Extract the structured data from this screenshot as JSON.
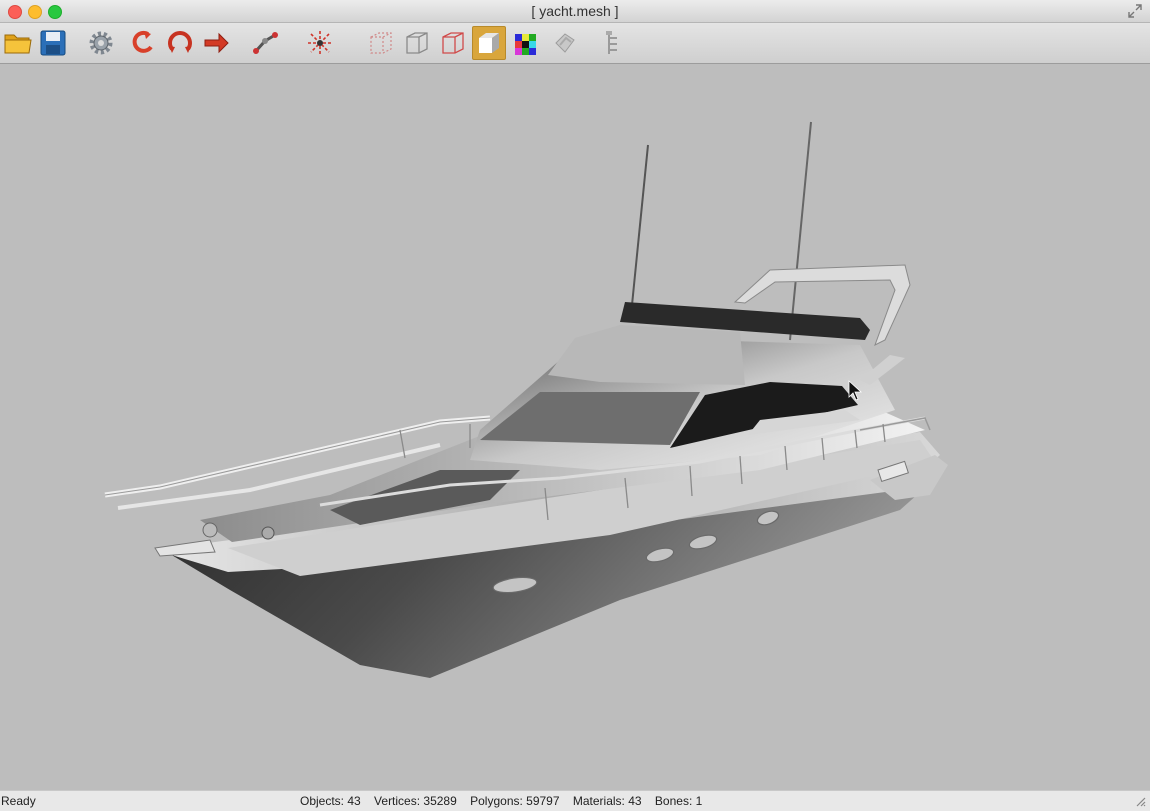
{
  "window": {
    "title": "[ yacht.mesh ]"
  },
  "toolbar": {
    "buttons": [
      {
        "name": "open",
        "icon": "folder-icon"
      },
      {
        "name": "save",
        "icon": "floppy-icon"
      },
      {
        "name": "settings",
        "icon": "gear-icon"
      },
      {
        "name": "rotate",
        "icon": "rotate-icon"
      },
      {
        "name": "orbit",
        "icon": "orbit-icon"
      },
      {
        "name": "pan",
        "icon": "pan-icon"
      },
      {
        "name": "bones",
        "icon": "bone-icon"
      },
      {
        "name": "center",
        "icon": "center-icon"
      },
      {
        "name": "points",
        "icon": "points-view-icon"
      },
      {
        "name": "wireframe",
        "icon": "wireframe-view-icon"
      },
      {
        "name": "hidden-line",
        "icon": "hidden-line-view-icon"
      },
      {
        "name": "shaded",
        "icon": "shaded-view-icon",
        "active": true
      },
      {
        "name": "textured",
        "icon": "textured-view-icon"
      },
      {
        "name": "animation",
        "icon": "animation-icon"
      },
      {
        "name": "hierarchy",
        "icon": "hierarchy-icon"
      }
    ]
  },
  "viewport": {
    "model": "yacht"
  },
  "status": {
    "text": "Ready",
    "objects": "Objects: 43",
    "vertices": "Vertices: 35289",
    "polygons": "Polygons: 59797",
    "materials": "Materials: 43",
    "bones": "Bones: 1"
  },
  "colors": {
    "viewport_bg": "#bdbdbd",
    "active_button": "#d9a63c"
  }
}
